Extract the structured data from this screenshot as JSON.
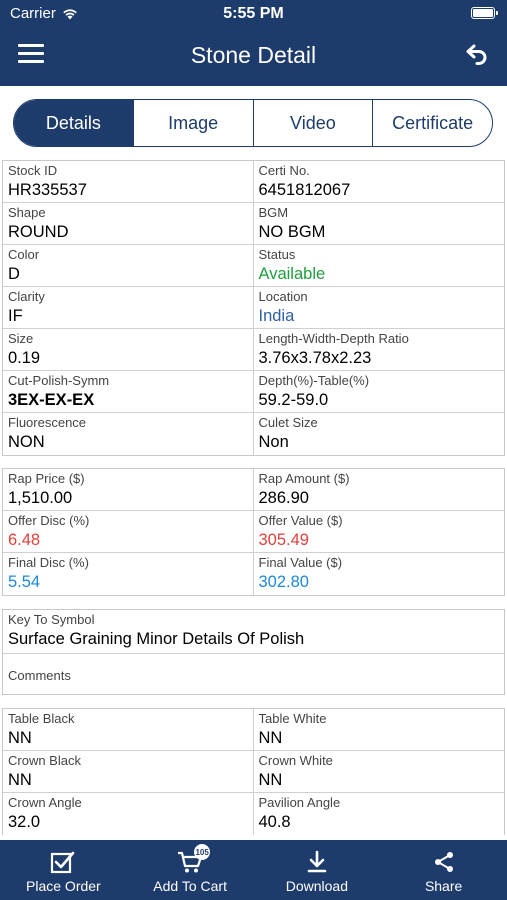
{
  "status_bar": {
    "carrier": "Carrier",
    "time": "5:55 PM"
  },
  "header": {
    "title": "Stone Detail",
    "menu_icon": "menu-icon",
    "back_icon": "back-arrow-icon"
  },
  "tabs": [
    {
      "label": "Details",
      "active": true
    },
    {
      "label": "Image",
      "active": false
    },
    {
      "label": "Video",
      "active": false
    },
    {
      "label": "Certificate",
      "active": false
    }
  ],
  "details": {
    "stock_id": {
      "label": "Stock ID",
      "value": "HR335537"
    },
    "certi_no": {
      "label": "Certi No.",
      "value": "6451812067"
    },
    "shape": {
      "label": "Shape",
      "value": "ROUND"
    },
    "bgm": {
      "label": "BGM",
      "value": "NO BGM"
    },
    "color": {
      "label": "Color",
      "value": "D"
    },
    "status": {
      "label": "Status",
      "value": "Available"
    },
    "clarity": {
      "label": "Clarity",
      "value": "IF"
    },
    "location": {
      "label": "Location",
      "value": "India"
    },
    "size": {
      "label": "Size",
      "value": "0.19"
    },
    "lwd_ratio": {
      "label": "Length-Width-Depth Ratio",
      "value": "3.76x3.78x2.23"
    },
    "cut_polish_symm": {
      "label": "Cut-Polish-Symm",
      "value": "3EX-EX-EX"
    },
    "depth_table": {
      "label": "Depth(%)-Table(%)",
      "value": "59.2-59.0"
    },
    "fluorescence": {
      "label": "Fluorescence",
      "value": "NON"
    },
    "culet_size": {
      "label": "Culet Size",
      "value": "Non"
    }
  },
  "pricing": {
    "rap_price": {
      "label": "Rap Price ($)",
      "value": "1,510.00"
    },
    "rap_amount": {
      "label": "Rap Amount ($)",
      "value": "286.90"
    },
    "offer_disc": {
      "label": "Offer Disc (%)",
      "value": "6.48"
    },
    "offer_value": {
      "label": "Offer Value ($)",
      "value": "305.49"
    },
    "final_disc": {
      "label": "Final Disc (%)",
      "value": "5.54"
    },
    "final_value": {
      "label": "Final Value ($)",
      "value": "302.80"
    }
  },
  "notes": {
    "key_to_symbol": {
      "label": "Key To Symbol",
      "value": "Surface Graining  Minor Details Of Polish"
    },
    "comments": {
      "label": "Comments",
      "value": ""
    }
  },
  "inclusions": {
    "table_black": {
      "label": "Table Black",
      "value": "NN"
    },
    "table_white": {
      "label": "Table White",
      "value": "NN"
    },
    "crown_black": {
      "label": "Crown Black",
      "value": "NN"
    },
    "crown_white": {
      "label": "Crown White",
      "value": "NN"
    },
    "crown_angle": {
      "label": "Crown Angle",
      "value": "32.0"
    },
    "pavilion_angle": {
      "label": "Pavilion Angle",
      "value": "40.8"
    }
  },
  "bottom_bar": {
    "place_order": "Place Order",
    "add_to_cart": "Add To Cart",
    "cart_count": "105",
    "download": "Download",
    "share": "Share"
  },
  "colors": {
    "primary": "#1d3b6b",
    "green": "#1f9d3a",
    "red": "#e0413a",
    "blue": "#1e88d9"
  }
}
